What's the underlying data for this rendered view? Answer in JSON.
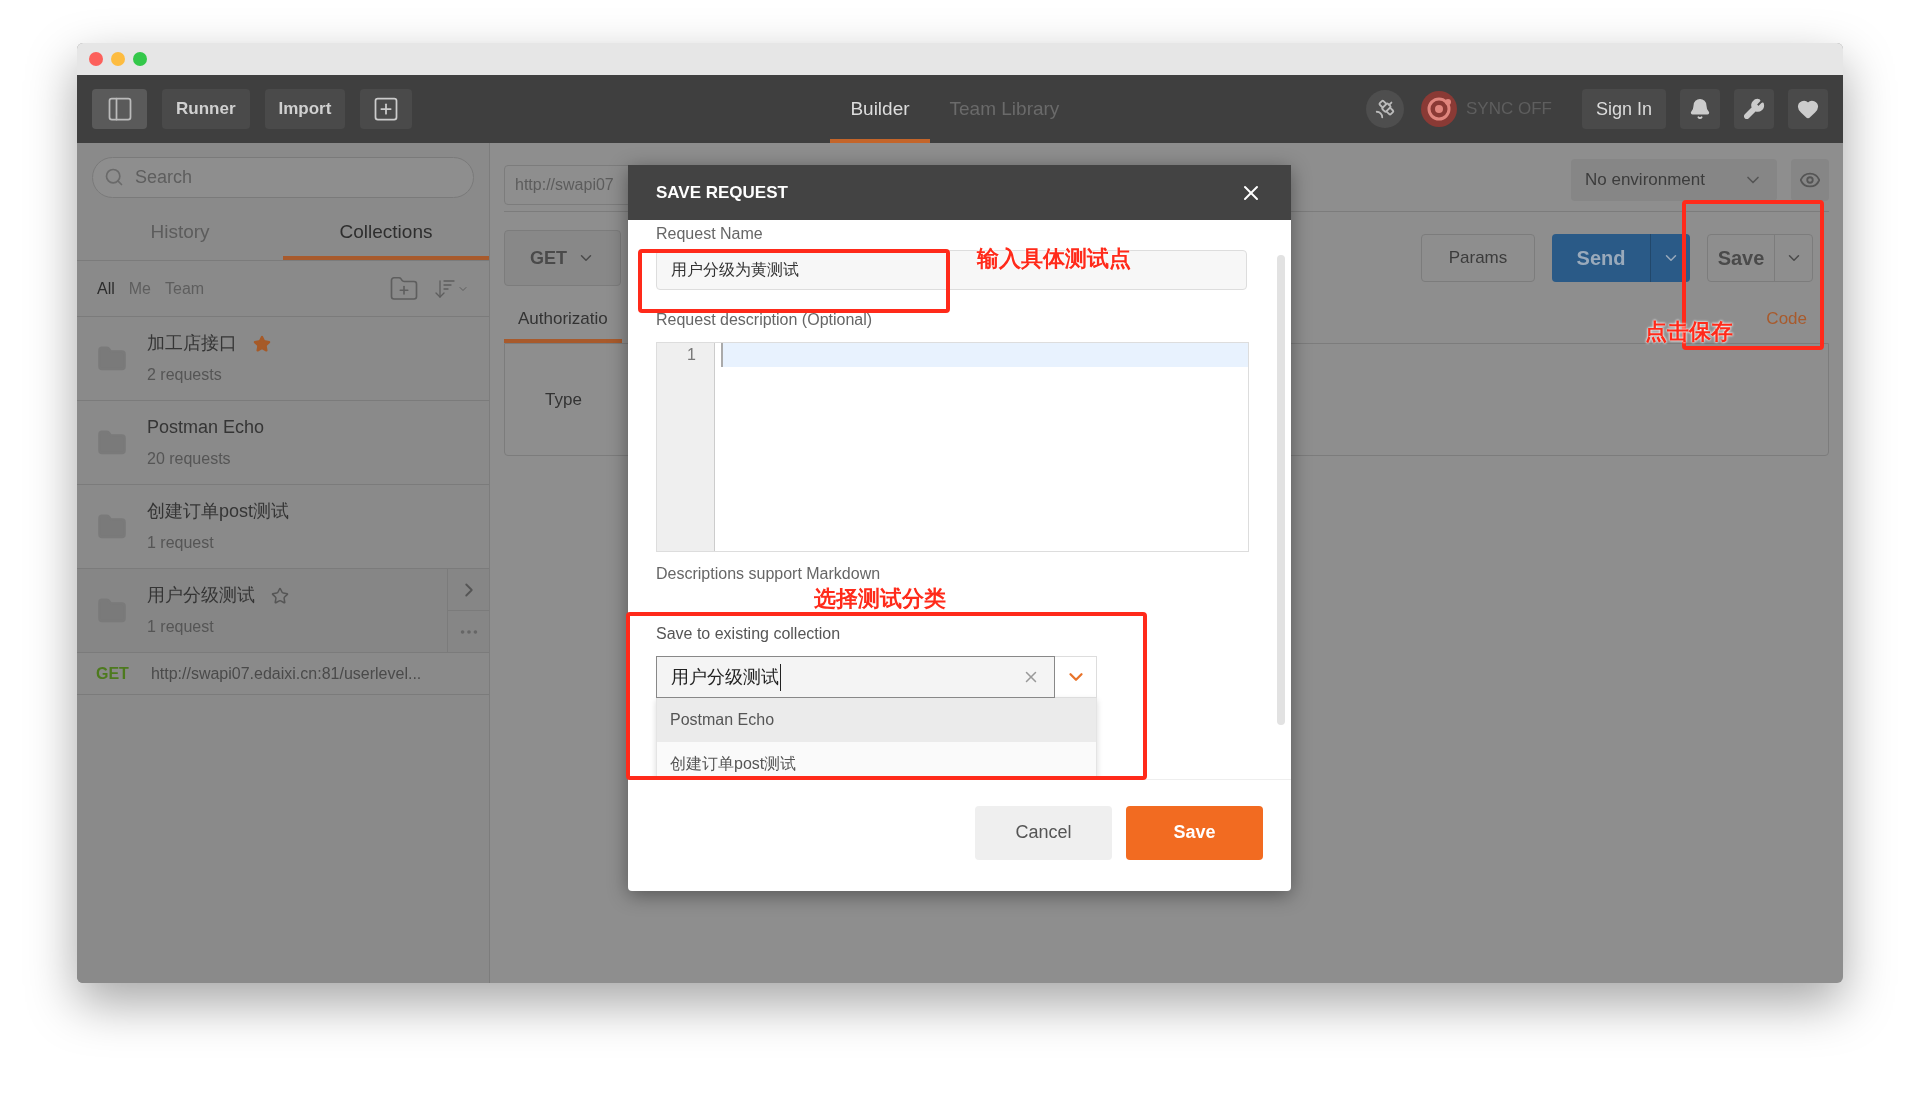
{
  "toolbar": {
    "runner": "Runner",
    "import": "Import",
    "tabs": [
      {
        "label": "Builder",
        "selected": true
      },
      {
        "label": "Team Library",
        "selected": false
      }
    ],
    "sync": "SYNC OFF",
    "sign_in": "Sign In"
  },
  "sidebar": {
    "search": {
      "placeholder": "Search"
    },
    "tabs": [
      {
        "label": "History",
        "selected": false
      },
      {
        "label": "Collections",
        "selected": true
      }
    ],
    "filters": [
      {
        "label": "All",
        "selected": true
      },
      {
        "label": "Me",
        "selected": false
      },
      {
        "label": "Team",
        "selected": false
      }
    ],
    "collections": [
      {
        "name": "加工店接口",
        "count": "2 requests",
        "starred": true,
        "hovered": false
      },
      {
        "name": "Postman Echo",
        "count": "20 requests",
        "starred": false,
        "hovered": false
      },
      {
        "name": "创建订单post测试",
        "count": "1 request",
        "starred": false,
        "hovered": false
      },
      {
        "name": "用户分级测试",
        "count": "1 request",
        "starred": false,
        "hovered": true
      }
    ],
    "history": [
      {
        "method": "GET",
        "url": "http://swapi07.edaixi.cn:81/userlevel..."
      }
    ]
  },
  "request": {
    "url": "http://swapi07",
    "environment": "No environment",
    "method": "GET",
    "params": "Params",
    "send": "Send",
    "save": "Save",
    "tabs": [
      {
        "label": "Authorizatio",
        "selected": true
      }
    ],
    "code_link": "Code",
    "type_label": "Type"
  },
  "dialog": {
    "title": "SAVE REQUEST",
    "name_label": "Request Name",
    "name_value": "用户分级为黄测试",
    "description_label": "Request description (Optional)",
    "line_number": "1",
    "markdown_note": "Descriptions support Markdown",
    "collection_label": "Save to existing collection",
    "collection_value": "用户分级测试",
    "options": [
      {
        "label": "Postman Echo",
        "selected": true
      },
      {
        "label": "创建订单post测试",
        "selected": false
      }
    ],
    "cancel": "Cancel",
    "save": "Save"
  },
  "annotations": [
    {
      "text": "输入具体测试点"
    },
    {
      "text": "点击保存"
    },
    {
      "text": "选择测试分类"
    }
  ]
}
